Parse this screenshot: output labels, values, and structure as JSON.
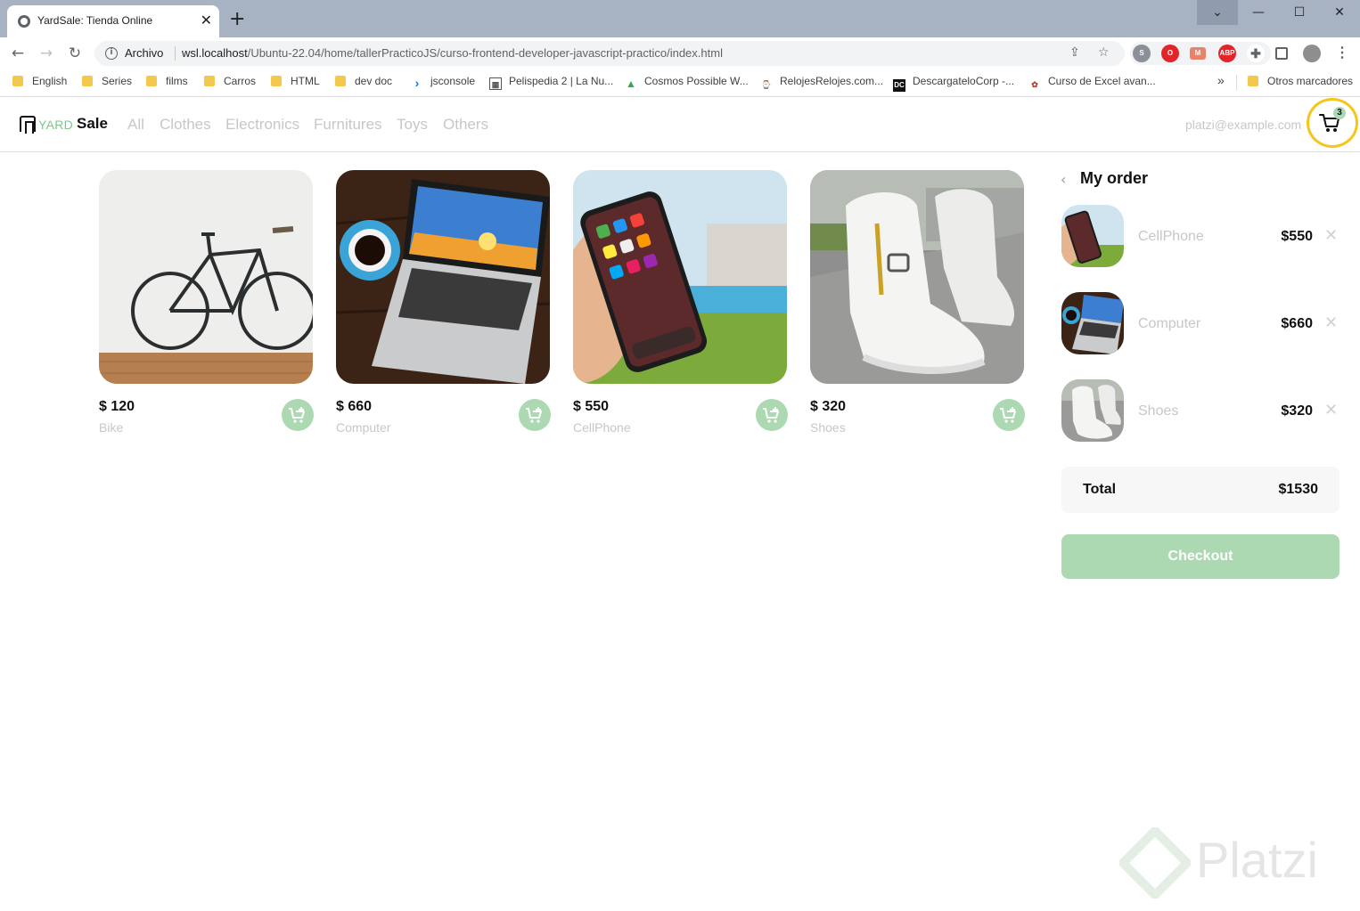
{
  "browser": {
    "tab_title": "YardSale: Tienda Online",
    "tab_close": "✕",
    "new_tab": "+",
    "window_buttons": {
      "tablist": "⌄",
      "minimize": "—",
      "maximize": "☐",
      "close": "✕"
    },
    "nav": {
      "back": "←",
      "forward": "→",
      "reload": "↻"
    },
    "omnibox": {
      "security_label": "Archivo",
      "url_host": "wsl.localhost",
      "url_path": "/Ubuntu-22.04/home/tallerPracticoJS/curso-frontend-developer-javascript-practico/index.html"
    },
    "bookmarks": [
      {
        "label": "English",
        "icon": "folder-icon"
      },
      {
        "label": "Series",
        "icon": "folder-icon"
      },
      {
        "label": "films",
        "icon": "folder-icon"
      },
      {
        "label": "Carros",
        "icon": "folder-icon"
      },
      {
        "label": "HTML",
        "icon": "folder-icon"
      },
      {
        "label": "dev doc",
        "icon": "folder-icon"
      },
      {
        "label": "jsconsole",
        "icon": "chevron-icon"
      },
      {
        "label": "Pelispedia 2 | La Nu...",
        "icon": "film-icon"
      },
      {
        "label": "Cosmos Possible W...",
        "icon": "drive-icon"
      },
      {
        "label": "RelojesRelojes.com...",
        "icon": "watch-icon"
      },
      {
        "label": "DescargateloCorp -...",
        "icon": "dc-icon"
      },
      {
        "label": "Curso de Excel avan...",
        "icon": "excel-course-icon"
      }
    ],
    "bookmarks_overflow": "»",
    "other_bookmarks": "Otros marcadores"
  },
  "header": {
    "logo_yard": "YARD",
    "logo_sale": "Sale",
    "categories": [
      "All",
      "Clothes",
      "Electronics",
      "Furnitures",
      "Toys",
      "Others"
    ],
    "email": "platzi@example.com",
    "cart_count": "3"
  },
  "products": [
    {
      "price": "$ 120",
      "name": "Bike"
    },
    {
      "price": "$ 660",
      "name": "Computer"
    },
    {
      "price": "$ 550",
      "name": "CellPhone"
    },
    {
      "price": "$ 320",
      "name": "Shoes"
    }
  ],
  "order": {
    "back_icon": "‹",
    "title": "My order",
    "items": [
      {
        "name": "CellPhone",
        "price": "$550"
      },
      {
        "name": "Computer",
        "price": "$660"
      },
      {
        "name": "Shoes",
        "price": "$320"
      }
    ],
    "remove_icon": "✕",
    "total_label": "Total",
    "total_value": "$1530",
    "checkout_label": "Checkout"
  },
  "watermark": "Platzi",
  "colors": {
    "accent": "#acd9b2",
    "brand_green": "#7bc88f",
    "highlight": "#f5c518",
    "muted": "#c7c7c7"
  }
}
